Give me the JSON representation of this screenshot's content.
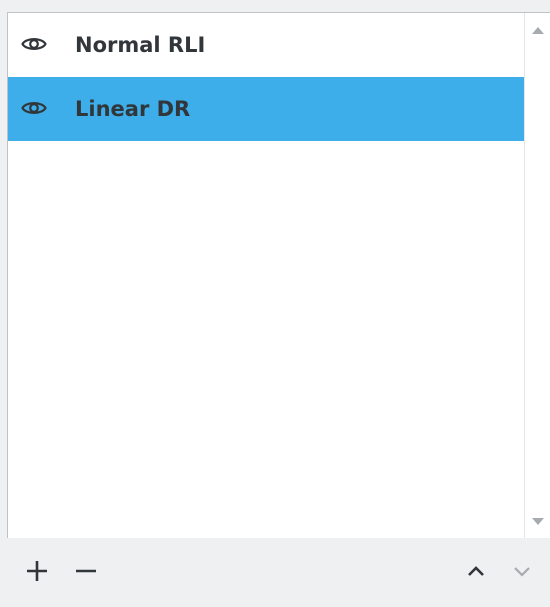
{
  "layers": {
    "items": [
      {
        "label": "Normal RLI",
        "visible": true,
        "selected": false,
        "icon": "eye-icon"
      },
      {
        "label": "Linear DR",
        "visible": true,
        "selected": true,
        "icon": "eye-icon"
      }
    ]
  },
  "toolbar": {
    "add_icon": "plus-icon",
    "remove_icon": "minus-icon",
    "move_up_icon": "chevron-up-icon",
    "move_down_icon": "chevron-down-icon"
  },
  "colors": {
    "selection": "#3daee9",
    "text": "#31363b",
    "panel_background": "#eff0f1",
    "list_background": "#ffffff",
    "disabled_icon": "#a7abaf"
  }
}
